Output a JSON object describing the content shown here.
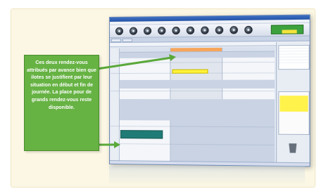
{
  "callout": {
    "text": "Ces deux rendez-vous attribués par avance bien que ilotes se justifient par leur situation en début et fin de journée. La place pour de grands rendez-vous reste disponible."
  },
  "colors": {
    "callout_bg": "#66b243",
    "panel_bg": "#fbf7e4",
    "appointment_morning": "#fff33a",
    "appointment_evening": "#1f7b76",
    "arrow": "#5aa83a"
  },
  "icons": [
    "toolbar-button-icon",
    "trash-icon"
  ]
}
